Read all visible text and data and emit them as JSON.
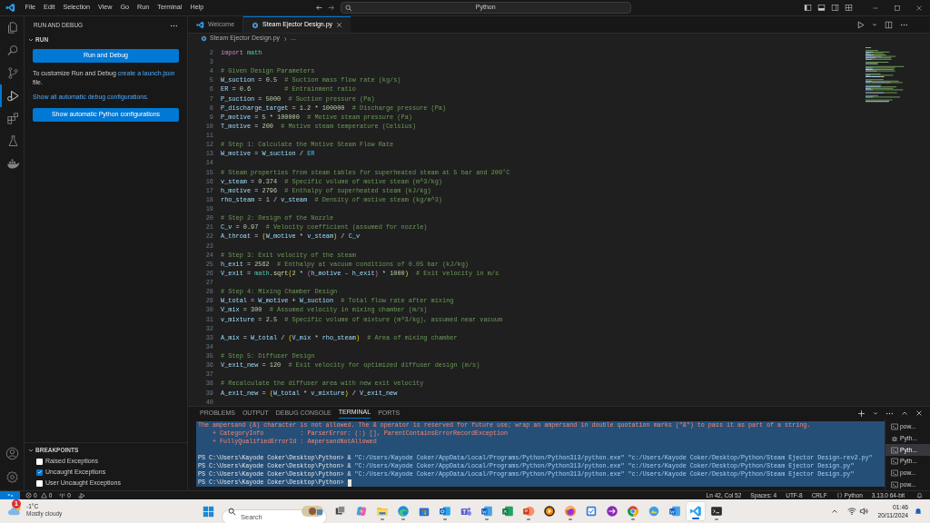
{
  "title_bar": {
    "menu": [
      "File",
      "Edit",
      "Selection",
      "View",
      "Go",
      "Run",
      "Terminal",
      "Help"
    ],
    "command_center": "Python"
  },
  "activity_bar": {
    "items": [
      {
        "kind": "explorer",
        "selected": false
      },
      {
        "kind": "search",
        "selected": false
      },
      {
        "kind": "scm",
        "selected": false
      },
      {
        "kind": "debug",
        "selected": true
      },
      {
        "kind": "extensions",
        "selected": false
      },
      {
        "kind": "testing",
        "selected": false
      },
      {
        "kind": "docker",
        "selected": false
      }
    ]
  },
  "sidebar": {
    "title": "RUN AND DEBUG",
    "run_section": {
      "title": "RUN",
      "expanded": true,
      "run_button": "Run and Debug",
      "hint_text": "To customize Run and Debug ",
      "hint_link": "create a launch.json",
      "hint_end": " file.",
      "debug_link": "Show all automatic debug configurations.",
      "python_button": "Show automatic Python configurations"
    },
    "breakpoints": {
      "title": "BREAKPOINTS",
      "expanded": true,
      "items": [
        {
          "label": "Raised Exceptions",
          "checked": false
        },
        {
          "label": "Uncaught Exceptions",
          "checked": true
        },
        {
          "label": "User Uncaught Exceptions",
          "checked": false
        }
      ]
    }
  },
  "tabs": [
    {
      "label": "Welcome",
      "kind": "welcome",
      "selected": false
    },
    {
      "label": "Steam Ejector Design.py",
      "kind": "python",
      "selected": true
    }
  ],
  "breadcrumb": {
    "file": "Steam Ejector Design.py",
    "rest": "..."
  },
  "editor": {
    "lines": [
      {
        "n": "2",
        "t": [
          {
            "kind": "keyword",
            "text": "import"
          },
          {
            "kind": "module",
            "text": " math"
          }
        ]
      },
      {
        "n": "3"
      },
      {
        "n": "4",
        "t": [
          {
            "kind": "comment",
            "text": "# Given Design Parameters"
          }
        ]
      },
      {
        "n": "5",
        "t": [
          {
            "kind": "name",
            "text": "W_suction"
          },
          {
            "kind": "op",
            "text": " = "
          },
          {
            "kind": "number",
            "text": "0.5"
          },
          {
            "kind": "comment",
            "text": "  # Suction mass flow rate (kg/s)"
          }
        ]
      },
      {
        "n": "6",
        "t": [
          {
            "kind": "name",
            "text": "ER"
          },
          {
            "kind": "op",
            "text": " = "
          },
          {
            "kind": "number",
            "text": "0.6"
          },
          {
            "kind": "comment",
            "text": "         # Entrainment ratio"
          }
        ]
      },
      {
        "n": "7",
        "t": [
          {
            "kind": "name",
            "text": "P_suction"
          },
          {
            "kind": "op",
            "text": " = "
          },
          {
            "kind": "number",
            "text": "5000"
          },
          {
            "kind": "comment",
            "text": "  # Suction pressure (Pa)"
          }
        ]
      },
      {
        "n": "8",
        "t": [
          {
            "kind": "name",
            "text": "P_discharge_target"
          },
          {
            "kind": "op",
            "text": " = "
          },
          {
            "kind": "number",
            "text": "1.2"
          },
          {
            "kind": "op",
            "text": " * "
          },
          {
            "kind": "number",
            "text": "100000"
          },
          {
            "kind": "comment",
            "text": "  # Discharge pressure (Pa)"
          }
        ]
      },
      {
        "n": "9",
        "t": [
          {
            "kind": "name",
            "text": "P_motive"
          },
          {
            "kind": "op",
            "text": " = "
          },
          {
            "kind": "number",
            "text": "5"
          },
          {
            "kind": "op",
            "text": " * "
          },
          {
            "kind": "number",
            "text": "100000"
          },
          {
            "kind": "comment",
            "text": "  # Motive steam pressure (Pa)"
          }
        ]
      },
      {
        "n": "10",
        "t": [
          {
            "kind": "name",
            "text": "T_motive"
          },
          {
            "kind": "op",
            "text": " = "
          },
          {
            "kind": "number",
            "text": "200"
          },
          {
            "kind": "comment",
            "text": "  # Motive steam temperature (Celsius)"
          }
        ]
      },
      {
        "n": "11"
      },
      {
        "n": "12",
        "t": [
          {
            "kind": "comment",
            "text": "# Step 1: Calculate the Motive Steam Flow Rate"
          }
        ]
      },
      {
        "n": "13",
        "t": [
          {
            "kind": "name",
            "text": "W_motive"
          },
          {
            "kind": "op",
            "text": " = "
          },
          {
            "kind": "name",
            "text": "W_suction"
          },
          {
            "kind": "op",
            "text": " / "
          },
          {
            "kind": "constant",
            "text": "ER"
          }
        ]
      },
      {
        "n": "14"
      },
      {
        "n": "15",
        "t": [
          {
            "kind": "comment",
            "text": "# Steam properties from steam tables for superheated steam at 5 bar and 200°C"
          }
        ]
      },
      {
        "n": "16",
        "t": [
          {
            "kind": "name",
            "text": "v_steam"
          },
          {
            "kind": "op",
            "text": " = "
          },
          {
            "kind": "number",
            "text": "0.374"
          },
          {
            "kind": "comment",
            "text": "  # Specific volume of motive steam (m^3/kg)"
          }
        ]
      },
      {
        "n": "17",
        "t": [
          {
            "kind": "name",
            "text": "h_motive"
          },
          {
            "kind": "op",
            "text": " = "
          },
          {
            "kind": "number",
            "text": "2796"
          },
          {
            "kind": "comment",
            "text": "  # Enthalpy of superheated steam (kJ/kg)"
          }
        ]
      },
      {
        "n": "18",
        "t": [
          {
            "kind": "name",
            "text": "rho_steam"
          },
          {
            "kind": "op",
            "text": " = "
          },
          {
            "kind": "number",
            "text": "1"
          },
          {
            "kind": "op",
            "text": " / "
          },
          {
            "kind": "name",
            "text": "v_steam"
          },
          {
            "kind": "comment",
            "text": "  # Density of motive steam (kg/m^3)"
          }
        ]
      },
      {
        "n": "19"
      },
      {
        "n": "20",
        "t": [
          {
            "kind": "comment",
            "text": "# Step 2: Design of the Nozzle"
          }
        ]
      },
      {
        "n": "21",
        "t": [
          {
            "kind": "name",
            "text": "C_v"
          },
          {
            "kind": "op",
            "text": " = "
          },
          {
            "kind": "number",
            "text": "0.97"
          },
          {
            "kind": "comment",
            "text": "  # Velocity coefficient (assumed for nozzle)"
          }
        ]
      },
      {
        "n": "22",
        "t": [
          {
            "kind": "name",
            "text": "A_throat"
          },
          {
            "kind": "op",
            "text": " = "
          },
          {
            "kind": "paren",
            "text": "("
          },
          {
            "kind": "name",
            "text": "W_motive"
          },
          {
            "kind": "op",
            "text": " * "
          },
          {
            "kind": "name",
            "text": "v_steam"
          },
          {
            "kind": "paren",
            "text": ")"
          },
          {
            "kind": "op",
            "text": " / "
          },
          {
            "kind": "name",
            "text": "C_v"
          }
        ]
      },
      {
        "n": "23"
      },
      {
        "n": "24",
        "t": [
          {
            "kind": "comment",
            "text": "# Step 3: Exit velocity of the steam"
          }
        ]
      },
      {
        "n": "25",
        "t": [
          {
            "kind": "name",
            "text": "h_exit"
          },
          {
            "kind": "op",
            "text": " = "
          },
          {
            "kind": "number",
            "text": "2562"
          },
          {
            "kind": "comment",
            "text": "  # Enthalpy at vacuum conditions of 0.05 bar (kJ/kg)"
          }
        ]
      },
      {
        "n": "26",
        "t": [
          {
            "kind": "name",
            "text": "V_exit"
          },
          {
            "kind": "op",
            "text": " = "
          },
          {
            "kind": "module",
            "text": "math"
          },
          {
            "kind": "op",
            "text": "."
          },
          {
            "kind": "function",
            "text": "sqrt"
          },
          {
            "kind": "paren",
            "text": "("
          },
          {
            "kind": "number",
            "text": "2"
          },
          {
            "kind": "op",
            "text": " * "
          },
          {
            "kind": "paren2",
            "text": "("
          },
          {
            "kind": "name",
            "text": "h_motive"
          },
          {
            "kind": "op",
            "text": " - "
          },
          {
            "kind": "name",
            "text": "h_exit"
          },
          {
            "kind": "paren2",
            "text": ")"
          },
          {
            "kind": "op",
            "text": " * "
          },
          {
            "kind": "number",
            "text": "1000"
          },
          {
            "kind": "paren",
            "text": ")"
          },
          {
            "kind": "comment",
            "text": "  # Exit velocity in m/s"
          }
        ]
      },
      {
        "n": "27"
      },
      {
        "n": "28",
        "t": [
          {
            "kind": "comment",
            "text": "# Step 4: Mixing Chamber Design"
          }
        ]
      },
      {
        "n": "29",
        "t": [
          {
            "kind": "name",
            "text": "W_total"
          },
          {
            "kind": "op",
            "text": " = "
          },
          {
            "kind": "name",
            "text": "W_motive"
          },
          {
            "kind": "op",
            "text": " + "
          },
          {
            "kind": "name",
            "text": "W_suction"
          },
          {
            "kind": "comment",
            "text": "  # Total flow rate after mixing"
          }
        ]
      },
      {
        "n": "30",
        "t": [
          {
            "kind": "name",
            "text": "V_mix"
          },
          {
            "kind": "op",
            "text": " = "
          },
          {
            "kind": "number",
            "text": "300"
          },
          {
            "kind": "comment",
            "text": "  # Assumed velocity in mixing chamber (m/s)"
          }
        ]
      },
      {
        "n": "31",
        "t": [
          {
            "kind": "name",
            "text": "v_mixture"
          },
          {
            "kind": "op",
            "text": " = "
          },
          {
            "kind": "number",
            "text": "2.5"
          },
          {
            "kind": "comment",
            "text": "  # Specific volume of mixture (m^3/kg), assumed near vacuum"
          }
        ]
      },
      {
        "n": "32"
      },
      {
        "n": "33",
        "t": [
          {
            "kind": "name",
            "text": "A_mix"
          },
          {
            "kind": "op",
            "text": " = "
          },
          {
            "kind": "name",
            "text": "W_total"
          },
          {
            "kind": "op",
            "text": " / "
          },
          {
            "kind": "paren",
            "text": "("
          },
          {
            "kind": "name",
            "text": "V_mix"
          },
          {
            "kind": "op",
            "text": " * "
          },
          {
            "kind": "name",
            "text": "rho_steam"
          },
          {
            "kind": "paren",
            "text": ")"
          },
          {
            "kind": "comment",
            "text": "  # Area of mixing chamber"
          }
        ]
      },
      {
        "n": "34"
      },
      {
        "n": "35",
        "t": [
          {
            "kind": "comment",
            "text": "# Step 5: Diffuser Design"
          }
        ]
      },
      {
        "n": "36",
        "t": [
          {
            "kind": "name",
            "text": "V_exit_new"
          },
          {
            "kind": "op",
            "text": " = "
          },
          {
            "kind": "number",
            "text": "120"
          },
          {
            "kind": "comment",
            "text": "  # Exit velocity for optimized diffuser design (m/s)"
          }
        ]
      },
      {
        "n": "37"
      },
      {
        "n": "38",
        "t": [
          {
            "kind": "comment",
            "text": "# Recalculate the diffuser area with new exit velocity"
          }
        ]
      },
      {
        "n": "39",
        "t": [
          {
            "kind": "name",
            "text": "A_exit_new"
          },
          {
            "kind": "op",
            "text": " = "
          },
          {
            "kind": "paren",
            "text": "("
          },
          {
            "kind": "name",
            "text": "W_total"
          },
          {
            "kind": "op",
            "text": " * "
          },
          {
            "kind": "name",
            "text": "v_mixture"
          },
          {
            "kind": "paren",
            "text": ")"
          },
          {
            "kind": "op",
            "text": " / "
          },
          {
            "kind": "name",
            "text": "V_exit_new"
          }
        ]
      },
      {
        "n": "40"
      }
    ]
  },
  "panel": {
    "tabs": [
      {
        "label": "PROBLEMS",
        "selected": false
      },
      {
        "label": "OUTPUT",
        "selected": false
      },
      {
        "label": "DEBUG CONSOLE",
        "selected": false
      },
      {
        "label": "TERMINAL",
        "selected": true
      },
      {
        "label": "PORTS",
        "selected": false
      }
    ],
    "terminal": {
      "selection": true,
      "lines": [
        {
          "kind": "error",
          "text": "The ampersand (&) character is not allowed. The & operator is reserved for future use; wrap an ampersand in double quotation marks (\"&\") to pass it as part of a string."
        },
        {
          "kind": "error",
          "text": "    + CategoryInfo          : ParserError: (:) [], ParentContainsErrorRecordException"
        },
        {
          "kind": "error",
          "text": "    + FullyQualifiedErrorId : AmpersandNotAllowed"
        },
        {
          "kind": "blank"
        },
        {
          "kind": "command",
          "prompt": "PS C:\\Users\\Kayode Coker\\Desktop\\Python>",
          "op": "&",
          "args": [
            "\"C:/Users/Kayode Coker/AppData/Local/Programs/Python/Python313/python.exe\"",
            "\"c:/Users/Kayode Coker/Desktop/Python/Steam Ejector Design-rev2.py\""
          ]
        },
        {
          "kind": "command",
          "prompt": "PS C:\\Users\\Kayode Coker\\Desktop\\Python>",
          "op": "&",
          "args": [
            "\"C:/Users/Kayode Coker/AppData/Local/Programs/Python/Python313/python.exe\"",
            "\"c:/Users/Kayode Coker/Desktop/Python/Steam Ejector Design.py\""
          ]
        },
        {
          "kind": "command",
          "prompt": "PS C:\\Users\\Kayode Coker\\Desktop\\Python>",
          "op": "&",
          "args": [
            "\"C:/Users/Kayode Coker/AppData/Local/Programs/Python/Python313/python.exe\"",
            "\"c:/Users/Kayode Coker/Desktop/Python/Steam Ejector Design.py\""
          ]
        },
        {
          "kind": "prompt",
          "prompt": "PS C:\\Users\\Kayode Coker\\Desktop\\Python>",
          "cursor": true
        }
      ]
    },
    "sessions": [
      {
        "label": "pow...",
        "kind": "terminal",
        "selected": false
      },
      {
        "label": "Pyth...",
        "kind": "debug",
        "selected": false
      },
      {
        "label": "Pyth...",
        "kind": "terminal",
        "selected": true
      },
      {
        "label": "Pyth...",
        "kind": "terminal",
        "selected": false
      },
      {
        "label": "pow...",
        "kind": "terminal",
        "selected": false
      },
      {
        "label": "pow...",
        "kind": "terminal",
        "selected": false
      }
    ]
  },
  "status_bar": {
    "errors": "0",
    "warnings": "0",
    "ports": "0",
    "cursor": "Ln 42, Col 52",
    "indent": "Spaces: 4",
    "encoding": "UTF-8",
    "eol": "CRLF",
    "language": "Python",
    "interpreter": "3.13.0 64-bit"
  },
  "taskbar": {
    "weather": {
      "badge": "1",
      "temperature": "-1°C",
      "condition": "Mostly cloudy"
    },
    "search_placeholder": "Search",
    "apps": [
      {
        "kind": "taskview",
        "running": false,
        "selected": false
      },
      {
        "kind": "copilot",
        "running": false,
        "selected": false
      },
      {
        "kind": "files",
        "running": true,
        "selected": false
      },
      {
        "kind": "edge",
        "running": true,
        "selected": false
      },
      {
        "kind": "store",
        "running": false,
        "selected": false
      },
      {
        "kind": "outlook",
        "running": true,
        "selected": false
      },
      {
        "kind": "teams",
        "running": false,
        "selected": false
      },
      {
        "kind": "word",
        "running": true,
        "selected": false
      },
      {
        "kind": "excel",
        "running": false,
        "selected": false
      },
      {
        "kind": "powerpoint",
        "running": true,
        "selected": false
      },
      {
        "kind": "player",
        "running": false,
        "selected": false
      },
      {
        "kind": "firefox",
        "running": true,
        "selected": false
      },
      {
        "kind": "todo",
        "running": false,
        "selected": false
      },
      {
        "kind": "arrow",
        "running": false,
        "selected": false
      },
      {
        "kind": "chrome",
        "running": true,
        "selected": false
      },
      {
        "kind": "photos",
        "running": false,
        "selected": false
      },
      {
        "kind": "word",
        "running": false,
        "selected": false
      },
      {
        "kind": "vscode",
        "running": true,
        "selected": true
      },
      {
        "kind": "terminal",
        "running": true,
        "selected": false
      }
    ],
    "time": "01:46",
    "date": "20/11/2024"
  }
}
